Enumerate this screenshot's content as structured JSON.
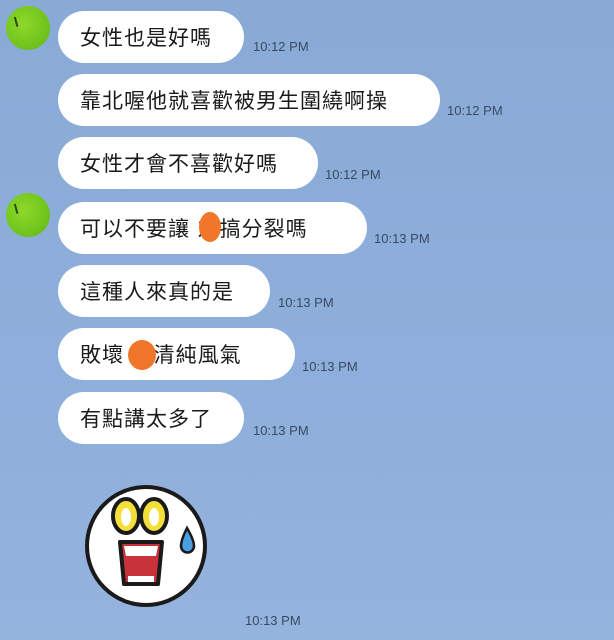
{
  "messages": [
    {
      "text": "女性也是好嗎",
      "time": "10:12 PM"
    },
    {
      "text": "靠北喔他就喜歡被男生圍繞啊操",
      "time": "10:12 PM"
    },
    {
      "text": "女性才會不喜歡好嗎",
      "time": "10:12 PM"
    },
    {
      "text": "可以不要讓 友搞分裂嗎",
      "time": "10:13 PM"
    },
    {
      "text": "這種人來真的是",
      "time": "10:13 PM"
    },
    {
      "text": "敗壞 友清純風氣",
      "time": "10:13 PM"
    },
    {
      "text": "有點講太多了",
      "time": "10:13 PM"
    }
  ],
  "sticker": {
    "icon": "shocked-face-sticker-icon",
    "time": "10:13 PM"
  },
  "colors": {
    "bubble": "#ffffff",
    "avatar": "#6cc21a",
    "redaction": "#f0772a",
    "background": "#8eaedb"
  }
}
